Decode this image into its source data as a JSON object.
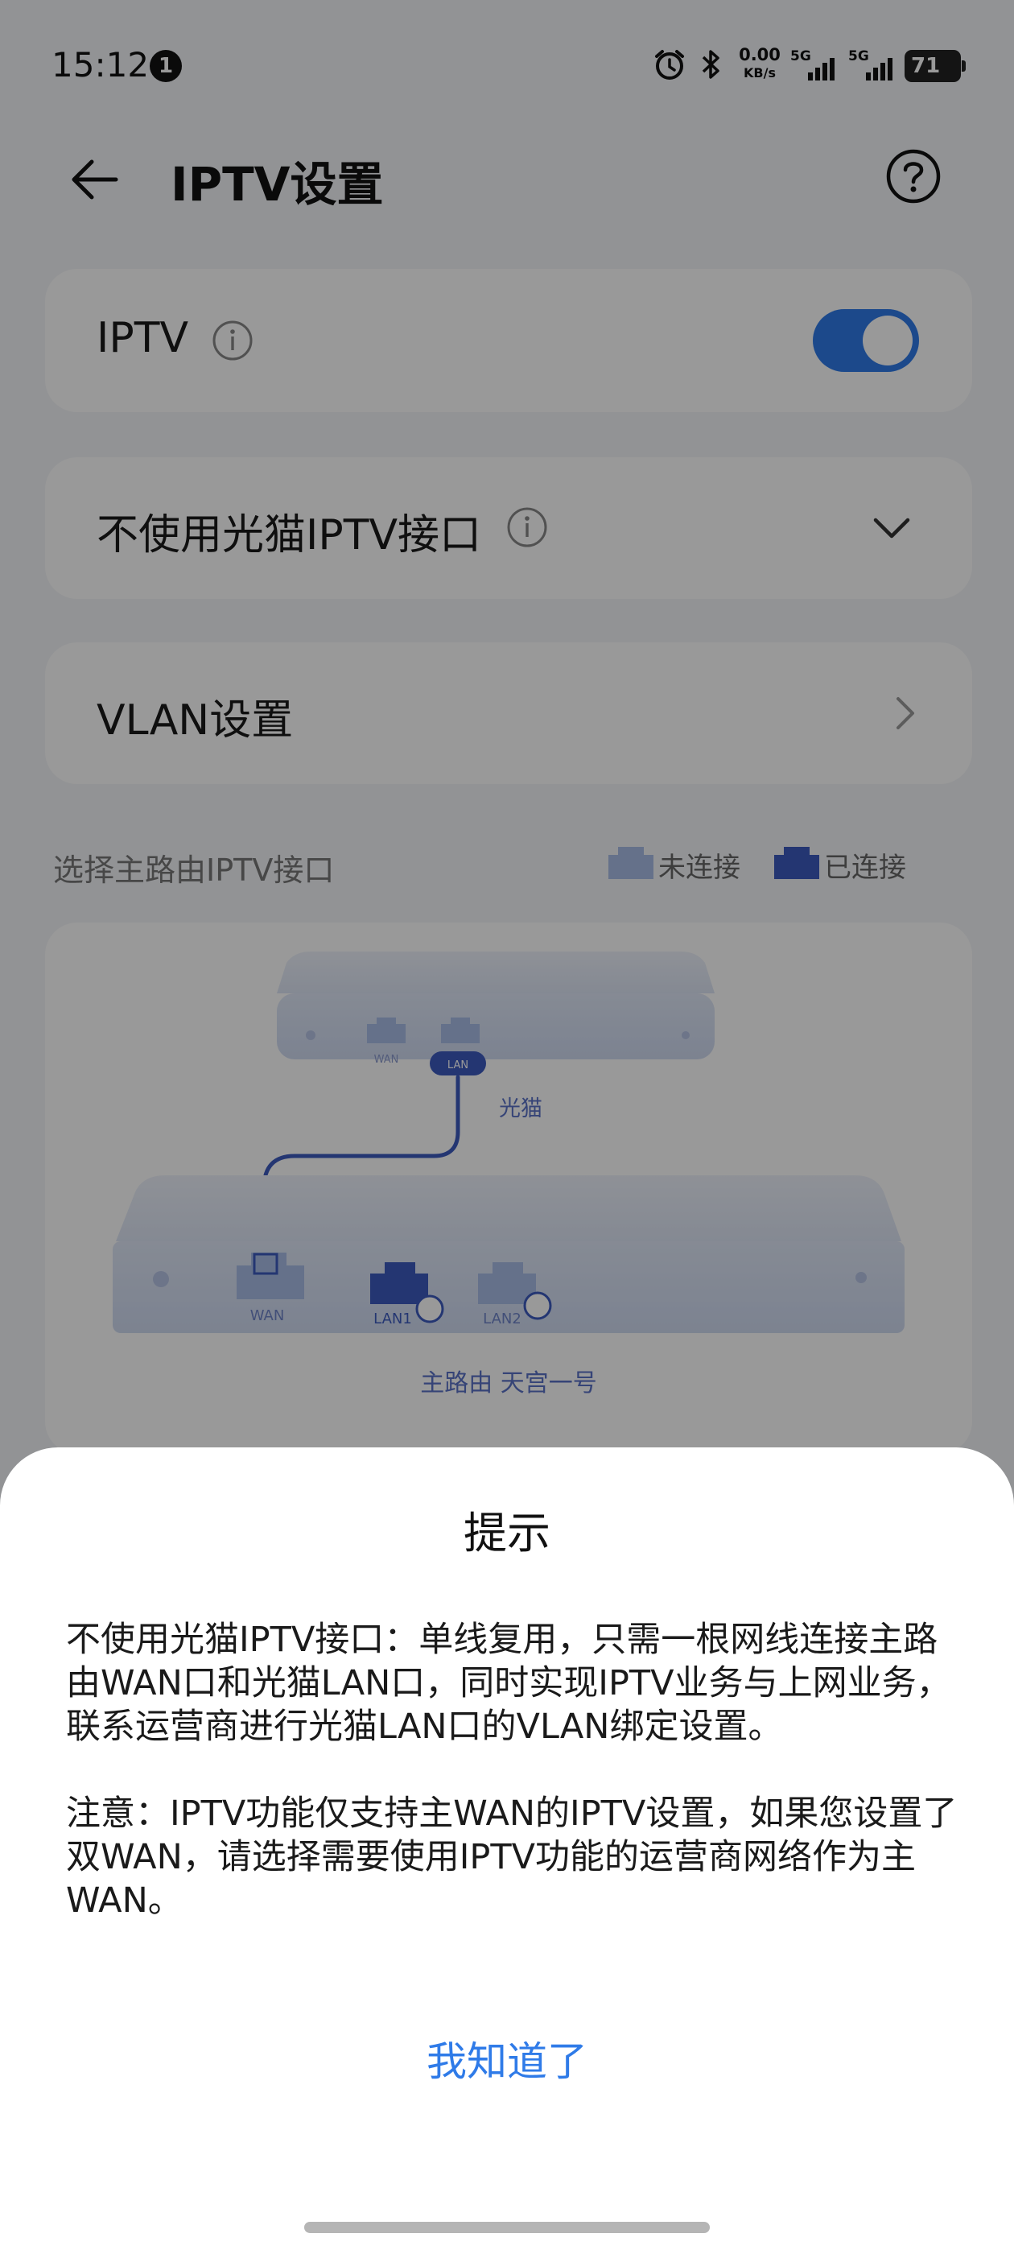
{
  "status_bar": {
    "time": "15:12",
    "notification_count": "1",
    "net_speed_value": "0.00",
    "net_speed_unit": "KB/s",
    "signal_1_label": "5G",
    "signal_2_label": "5G",
    "battery": "71"
  },
  "header": {
    "title": "IPTV设置"
  },
  "iptv_card": {
    "label": "IPTV",
    "toggle_on": true
  },
  "mode_card": {
    "label": "不使用光猫IPTV接口"
  },
  "vlan_card": {
    "label": "VLAN设置"
  },
  "port_section": {
    "label": "选择主路由IPTV接口",
    "legend_unconnected": "未连接",
    "legend_connected": "已连接",
    "modem_label": "光猫",
    "modem_wan": "WAN",
    "modem_lan": "LAN",
    "router_wan": "WAN",
    "router_lan1": "LAN1",
    "router_lan2": "LAN2",
    "router_name": "主路由 天宫一号"
  },
  "dialog": {
    "title": "提示",
    "paragraph_1": "不使用光猫IPTV接口：单线复用，只需一根网线连接主路由WAN口和光猫LAN口，同时实现IPTV业务与上网业务，联系运营商进行光猫LAN口的VLAN绑定设置。",
    "paragraph_2": "注意：IPTV功能仅支持主WAN的IPTV设置，如果您设置了双WAN，请选择需要使用IPTV功能的运营商网络作为主WAN。",
    "confirm_label": "我知道了"
  },
  "colors": {
    "accent": "#2f7be8",
    "port_connected": "#3d5bbf",
    "port_unconnected": "#a9bde6"
  }
}
